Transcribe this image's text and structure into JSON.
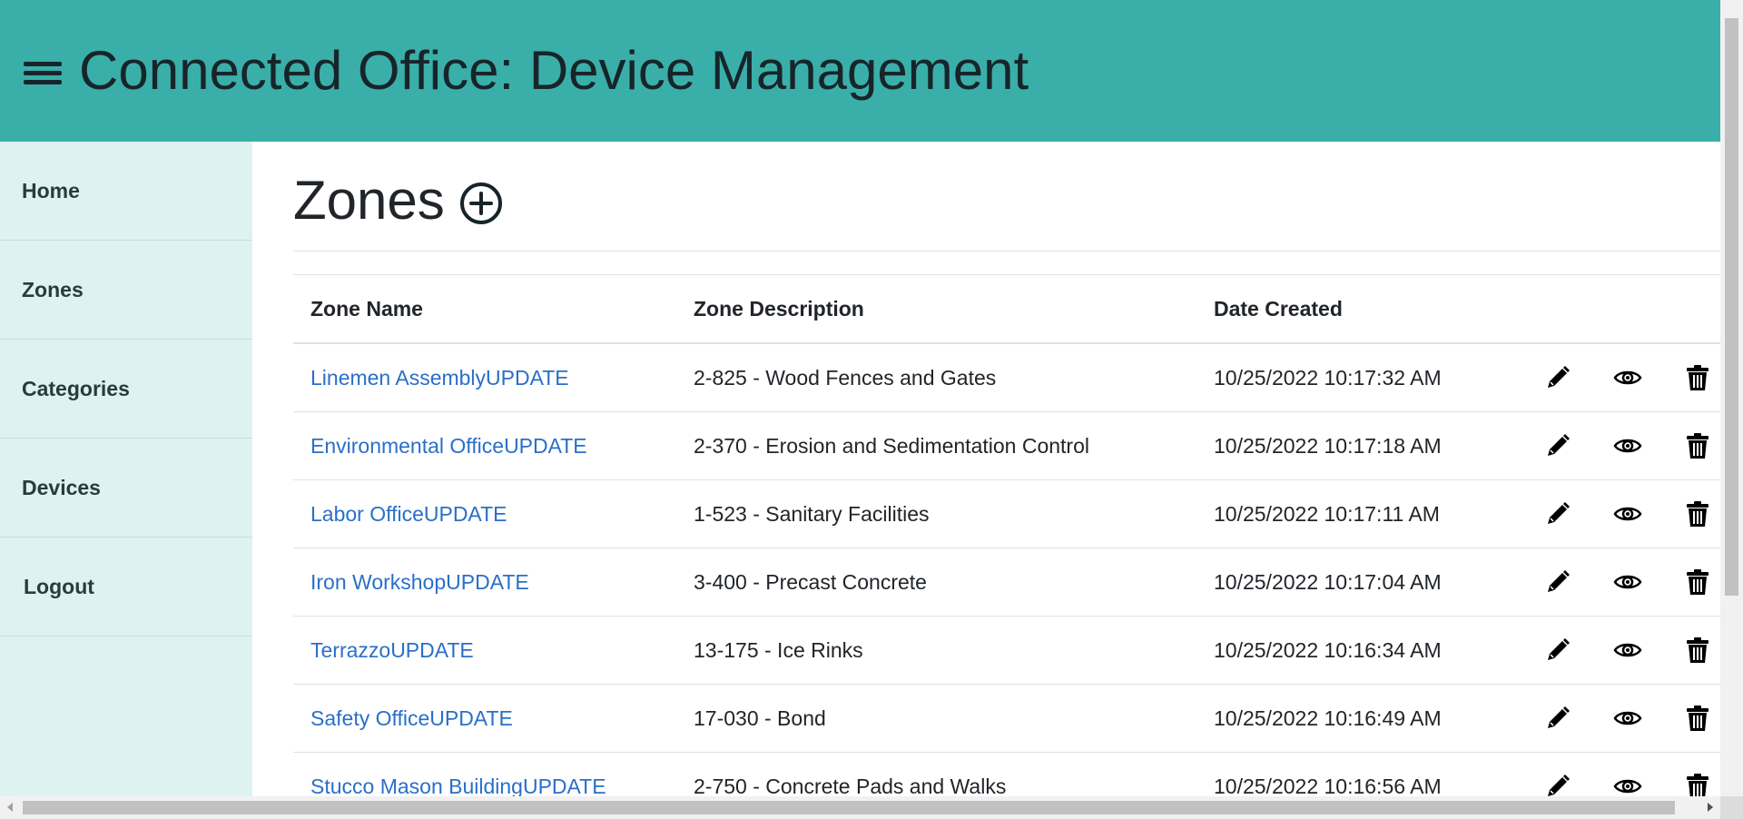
{
  "header": {
    "title": "Connected Office: Device Management",
    "menu_icon": "hamburger-menu-icon",
    "background": "#3aafa9"
  },
  "sidebar": {
    "background": "#def2f1",
    "items": [
      {
        "label": "Home"
      },
      {
        "label": "Zones"
      },
      {
        "label": "Categories"
      },
      {
        "label": "Devices"
      },
      {
        "label": "Logout"
      }
    ]
  },
  "main": {
    "page_title": "Zones",
    "add_icon": "plus-circle-icon",
    "table": {
      "columns": [
        "Zone Name",
        "Zone Description",
        "Date Created"
      ],
      "row_actions": [
        "pencil-icon",
        "eye-icon",
        "trash-icon"
      ],
      "rows": [
        {
          "name": "Linemen AssemblyUPDATE",
          "description": "2-825 - Wood Fences and Gates",
          "date": "10/25/2022 10:17:32 AM"
        },
        {
          "name": "Environmental OfficeUPDATE",
          "description": "2-370 - Erosion and Sedimentation Control",
          "date": "10/25/2022 10:17:18 AM"
        },
        {
          "name": "Labor OfficeUPDATE",
          "description": "1-523 - Sanitary Facilities",
          "date": "10/25/2022 10:17:11 AM"
        },
        {
          "name": "Iron WorkshopUPDATE",
          "description": "3-400 - Precast Concrete",
          "date": "10/25/2022 10:17:04 AM"
        },
        {
          "name": "TerrazzoUPDATE",
          "description": "13-175 - Ice Rinks",
          "date": "10/25/2022 10:16:34 AM"
        },
        {
          "name": "Safety OfficeUPDATE",
          "description": "17-030 - Bond",
          "date": "10/25/2022 10:16:49 AM"
        },
        {
          "name": "Stucco Mason BuildingUPDATE",
          "description": "2-750 - Concrete Pads and Walks",
          "date": "10/25/2022 10:16:56 AM"
        }
      ]
    }
  },
  "colors": {
    "link": "#2a6fc9",
    "text": "#212529",
    "header_text": "#17252a"
  }
}
